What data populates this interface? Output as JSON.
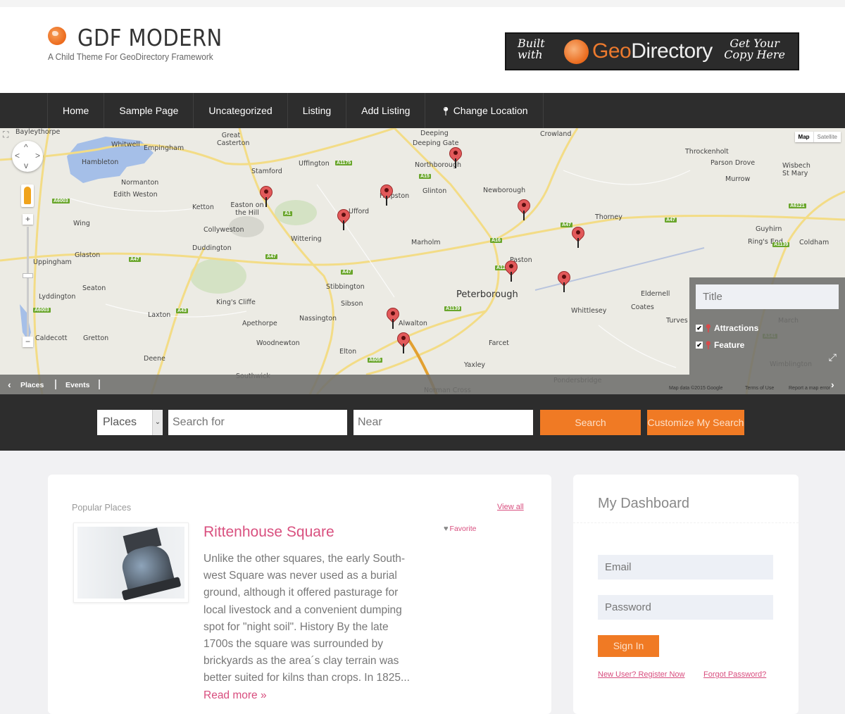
{
  "site": {
    "title": "GDF MODERN",
    "tagline": "A Child Theme For GeoDirectory Framework",
    "banner": {
      "left_text_1": "Built",
      "left_text_2": "with",
      "brand_geo": "Geo",
      "brand_rest": "Directory",
      "right_text_1": "Get Your",
      "right_text_2": "Copy Here"
    }
  },
  "nav": {
    "items": [
      {
        "label": "Home"
      },
      {
        "label": "Sample Page"
      },
      {
        "label": "Uncategorized"
      },
      {
        "label": "Listing"
      },
      {
        "label": "Add Listing"
      },
      {
        "label": "Change Location",
        "icon": "map-pin-icon"
      }
    ]
  },
  "map": {
    "map_type": {
      "active": "Map",
      "other": "Satellite"
    },
    "places": [
      {
        "name": "Peterborough",
        "big": true
      },
      {
        "name": "Stamford"
      },
      {
        "name": "Great Casterton"
      },
      {
        "name": "Uffington"
      },
      {
        "name": "Deeping"
      },
      {
        "name": "Deeping Gate"
      },
      {
        "name": "Northborough"
      },
      {
        "name": "Crowland"
      },
      {
        "name": "Throckenholt"
      },
      {
        "name": "Parson Drove"
      },
      {
        "name": "Wisbech St Mary"
      },
      {
        "name": "Murrow"
      },
      {
        "name": "Whitwell"
      },
      {
        "name": "Empingham"
      },
      {
        "name": "Hambleton"
      },
      {
        "name": "Normanton"
      },
      {
        "name": "Edith Weston"
      },
      {
        "name": "Ketton"
      },
      {
        "name": "Easton on the Hill"
      },
      {
        "name": "Helpston"
      },
      {
        "name": "Glinton"
      },
      {
        "name": "Newborough"
      },
      {
        "name": "Thorney"
      },
      {
        "name": "Guyhirn"
      },
      {
        "name": "Ring's End"
      },
      {
        "name": "Coldham"
      },
      {
        "name": "Wing"
      },
      {
        "name": "Collyweston"
      },
      {
        "name": "Ufford"
      },
      {
        "name": "Wittering"
      },
      {
        "name": "Marholm"
      },
      {
        "name": "Duddington"
      },
      {
        "name": "Glaston"
      },
      {
        "name": "Uppingham"
      },
      {
        "name": "Paston"
      },
      {
        "name": "Seaton"
      },
      {
        "name": "Lyddington"
      },
      {
        "name": "Stibbington"
      },
      {
        "name": "King's Cliffe"
      },
      {
        "name": "Sibson"
      },
      {
        "name": "Eldernell"
      },
      {
        "name": "Coates"
      },
      {
        "name": "Whittlesey"
      },
      {
        "name": "Laxton"
      },
      {
        "name": "Apethorpe"
      },
      {
        "name": "Nassington"
      },
      {
        "name": "Alwalton"
      },
      {
        "name": "Turves"
      },
      {
        "name": "March"
      },
      {
        "name": "Caldecott"
      },
      {
        "name": "Gretton"
      },
      {
        "name": "Woodnewton"
      },
      {
        "name": "Elton"
      },
      {
        "name": "Farcet"
      },
      {
        "name": "Deene"
      },
      {
        "name": "Yaxley"
      },
      {
        "name": "Southwick"
      },
      {
        "name": "Pondersbridge"
      },
      {
        "name": "Wimblington"
      },
      {
        "name": "Norman Cross"
      },
      {
        "name": "Bayleythorpe"
      }
    ],
    "roads": [
      "A1175",
      "A15",
      "A1",
      "A16",
      "A47",
      "A47",
      "A47",
      "A47",
      "A6003",
      "A6121",
      "A43",
      "A605",
      "A1139",
      "A1260",
      "A47",
      "A6003",
      "A1139",
      "A141"
    ],
    "filter_panel": {
      "title_placeholder": "Title",
      "categories": [
        {
          "label": "Attractions",
          "checked": true
        },
        {
          "label": "Feature",
          "checked": true
        }
      ]
    },
    "bottom_tabs": [
      "Places",
      "Events"
    ],
    "attribution": {
      "data": "Map data ©2015 Google",
      "terms": "Terms of Use",
      "report": "Report a map error"
    }
  },
  "search": {
    "type_value": "Places",
    "search_placeholder": "Search for",
    "near_placeholder": "Near",
    "search_button": "Search",
    "customize_button": "Customize My Search"
  },
  "popular": {
    "heading": "Popular Places",
    "view_all": "View all",
    "listing": {
      "name": "Rittenhouse Square",
      "favorite": "Favorite",
      "description": "Unlike the other squares, the early South-west Square was never used as a burial ground, although it offered pasturage for local livestock and a convenient dumping spot for \"night soil\". History By the late 1700s the square was surrounded by brickyards as the area´s clay terrain was better suited for kilns than crops. In 1825...",
      "read_more": "Read more »"
    }
  },
  "dashboard": {
    "title": "My Dashboard",
    "email_placeholder": "Email",
    "password_placeholder": "Password",
    "sign_in": "Sign In",
    "register_link": "New User? Register Now",
    "forgot_link": "Forgot Password?"
  },
  "colors": {
    "accent_orange": "#f07a24",
    "link_pink": "#d84d7e",
    "nav_dark": "#2d2d2d"
  }
}
